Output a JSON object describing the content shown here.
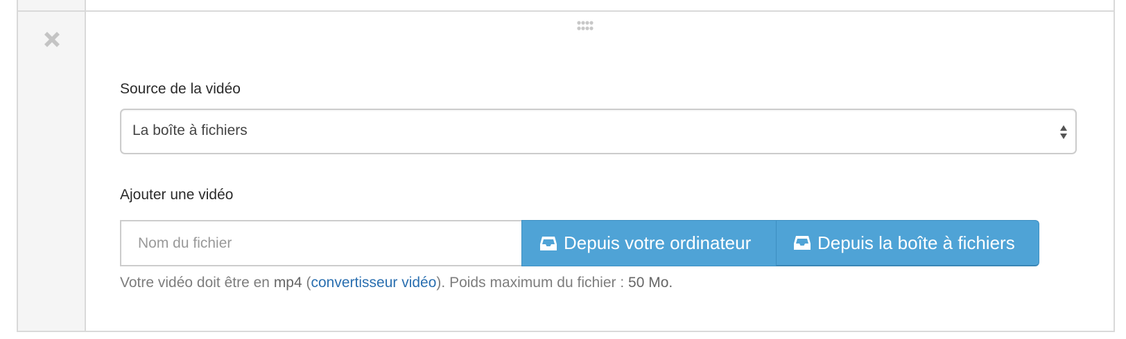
{
  "block": {
    "remove_icon": "close-icon",
    "drag_icon": "drag-handle-icon"
  },
  "source": {
    "label": "Source de la vidéo",
    "selected": "La boîte à fichiers"
  },
  "upload": {
    "label": "Ajouter une vidéo",
    "placeholder": "Nom du fichier",
    "btn_computer": "Depuis votre ordinateur",
    "btn_filebox": "Depuis la boîte à fichiers",
    "btn_icon": "inbox-tray-icon"
  },
  "help": {
    "prefix": "Votre vidéo doit être en ",
    "format": "mp4",
    "open_paren": " (",
    "link": "convertisseur vidéo",
    "close_paren": ").",
    "size_text": " Poids maximum du fichier : ",
    "size_value": "50 Mo."
  },
  "colors": {
    "button_blue": "#4fa3d6",
    "link_blue": "#2a6fb0",
    "gutter_bg": "#f5f5f5",
    "border": "#d9d9d9"
  }
}
